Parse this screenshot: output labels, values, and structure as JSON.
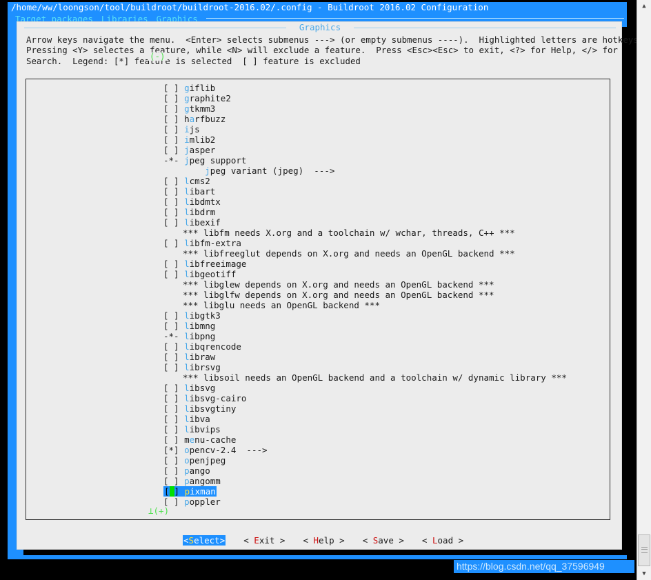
{
  "window": {
    "title": "/home/ww/loongson/tool/buildroot/buildroot-2016.02/.config - Buildroot 2016.02 Configuration"
  },
  "breadcrumb": {
    "items": [
      "Target packages",
      "Libraries",
      "Graphics"
    ]
  },
  "dialog": {
    "title": "Graphics",
    "help_text": "Arrow keys navigate the menu.  <Enter> selects submenus ---> (or empty submenus ----).  Highlighted letters are hotkeys.\nPressing <Y> selectes a feature, while <N> will exclude a feature.  Press <Esc><Esc> to exit, <?> for Help, </> for\nSearch.  Legend: [*] feature is selected  [ ] feature is excluded",
    "scroll_top_indicator": "(-)",
    "scroll_bottom_indicator": "⊥(+)"
  },
  "list": {
    "rows": [
      {
        "kind": "option",
        "mark": "[ ]",
        "hot": "g",
        "rest": "iflib"
      },
      {
        "kind": "option",
        "mark": "[ ]",
        "hot": "g",
        "rest": "raphite2"
      },
      {
        "kind": "option",
        "mark": "[ ]",
        "hot": "g",
        "rest": "tkmm3"
      },
      {
        "kind": "option",
        "mark": "[ ]",
        "pre": "h",
        "hot": "a",
        "rest": "rfbuzz"
      },
      {
        "kind": "option",
        "mark": "[ ]",
        "hot": "i",
        "rest": "js"
      },
      {
        "kind": "option",
        "mark": "[ ]",
        "hot": "i",
        "rest": "mlib2"
      },
      {
        "kind": "option",
        "mark": "[ ]",
        "hot": "j",
        "rest": "asper"
      },
      {
        "kind": "option",
        "mark": "-*-",
        "hot": "j",
        "rest": "peg support"
      },
      {
        "kind": "submenu",
        "mark": "   ",
        "indent": "    ",
        "hot": "j",
        "rest": "peg variant (jpeg)  --->"
      },
      {
        "kind": "option",
        "mark": "[ ]",
        "hot": "l",
        "rest": "cms2"
      },
      {
        "kind": "option",
        "mark": "[ ]",
        "hot": "l",
        "rest": "ibart"
      },
      {
        "kind": "option",
        "mark": "[ ]",
        "hot": "l",
        "rest": "ibdmtx"
      },
      {
        "kind": "option",
        "mark": "[ ]",
        "hot": "l",
        "rest": "ibdrm"
      },
      {
        "kind": "option",
        "mark": "[ ]",
        "hot": "l",
        "rest": "ibexif"
      },
      {
        "kind": "comment",
        "text": "*** libfm needs X.org and a toolchain w/ wchar, threads, C++ ***"
      },
      {
        "kind": "option",
        "mark": "[ ]",
        "hot": "l",
        "rest": "ibfm-extra"
      },
      {
        "kind": "comment",
        "text": "*** libfreeglut depends on X.org and needs an OpenGL backend ***"
      },
      {
        "kind": "option",
        "mark": "[ ]",
        "hot": "l",
        "rest": "ibfreeimage"
      },
      {
        "kind": "option",
        "mark": "[ ]",
        "hot": "l",
        "rest": "ibgeotiff"
      },
      {
        "kind": "comment",
        "text": "*** libglew depends on X.org and needs an OpenGL backend ***"
      },
      {
        "kind": "comment",
        "text": "*** libglfw depends on X.org and needs an OpenGL backend ***"
      },
      {
        "kind": "comment",
        "text": "*** libglu needs an OpenGL backend ***"
      },
      {
        "kind": "option",
        "mark": "[ ]",
        "hot": "l",
        "rest": "ibgtk3"
      },
      {
        "kind": "option",
        "mark": "[ ]",
        "hot": "l",
        "rest": "ibmng"
      },
      {
        "kind": "option",
        "mark": "-*-",
        "hot": "l",
        "rest": "ibpng"
      },
      {
        "kind": "option",
        "mark": "[ ]",
        "hot": "l",
        "rest": "ibqrencode"
      },
      {
        "kind": "option",
        "mark": "[ ]",
        "hot": "l",
        "rest": "ibraw"
      },
      {
        "kind": "option",
        "mark": "[ ]",
        "hot": "l",
        "rest": "ibrsvg"
      },
      {
        "kind": "comment",
        "text": "*** libsoil needs an OpenGL backend and a toolchain w/ dynamic library ***"
      },
      {
        "kind": "option",
        "mark": "[ ]",
        "hot": "l",
        "rest": "ibsvg"
      },
      {
        "kind": "option",
        "mark": "[ ]",
        "hot": "l",
        "rest": "ibsvg-cairo"
      },
      {
        "kind": "option",
        "mark": "[ ]",
        "hot": "l",
        "rest": "ibsvgtiny"
      },
      {
        "kind": "option",
        "mark": "[ ]",
        "hot": "l",
        "rest": "ibva"
      },
      {
        "kind": "option",
        "mark": "[ ]",
        "hot": "l",
        "rest": "ibvips"
      },
      {
        "kind": "option",
        "mark": "[ ]",
        "pre": "m",
        "hot": "e",
        "rest": "nu-cache"
      },
      {
        "kind": "option",
        "mark": "[*]",
        "hot": "o",
        "rest": "pencv-2.4  --->"
      },
      {
        "kind": "option",
        "mark": "[ ]",
        "hot": "o",
        "rest": "penjpeg"
      },
      {
        "kind": "option",
        "mark": "[ ]",
        "hot": "p",
        "rest": "ango"
      },
      {
        "kind": "option",
        "mark": "[ ]",
        "hot": "p",
        "rest": "angomm"
      },
      {
        "kind": "option",
        "mark": "[ ]",
        "hot": "p",
        "rest": "ixman",
        "selected": true
      },
      {
        "kind": "option",
        "mark": "[ ]",
        "hot": "p",
        "rest": "oppler"
      }
    ]
  },
  "buttons": [
    {
      "label": "<Select>",
      "hot": "S",
      "pre": "<",
      "rest": "elect>",
      "active": true
    },
    {
      "label": "< Exit >",
      "pre": "< ",
      "hot": "E",
      "rest": "xit >",
      "active": false
    },
    {
      "label": "< Help >",
      "pre": "< ",
      "hot": "H",
      "rest": "elp >",
      "active": false
    },
    {
      "label": "< Save >",
      "pre": "< ",
      "hot": "S",
      "rest": "ave >",
      "active": false
    },
    {
      "label": "< Load >",
      "pre": "< ",
      "hot": "L",
      "rest": "oad >",
      "active": false
    }
  ],
  "watermark": {
    "text": "https://blog.csdn.net/qq_37596949"
  },
  "scrollbar": {
    "up_arrow": "▲",
    "down_arrow": "▼"
  },
  "colors": {
    "frame_blue": "#1e90ff",
    "hotkey_blue": "#4aa8e8",
    "hotkey_red": "#cc1111",
    "selected_bg": "#1e90ff",
    "selected_hot": "#ffe13b",
    "cursor_green": "#00e000",
    "indicator_green": "#4ce04c",
    "dialog_bg": "#ececec"
  }
}
